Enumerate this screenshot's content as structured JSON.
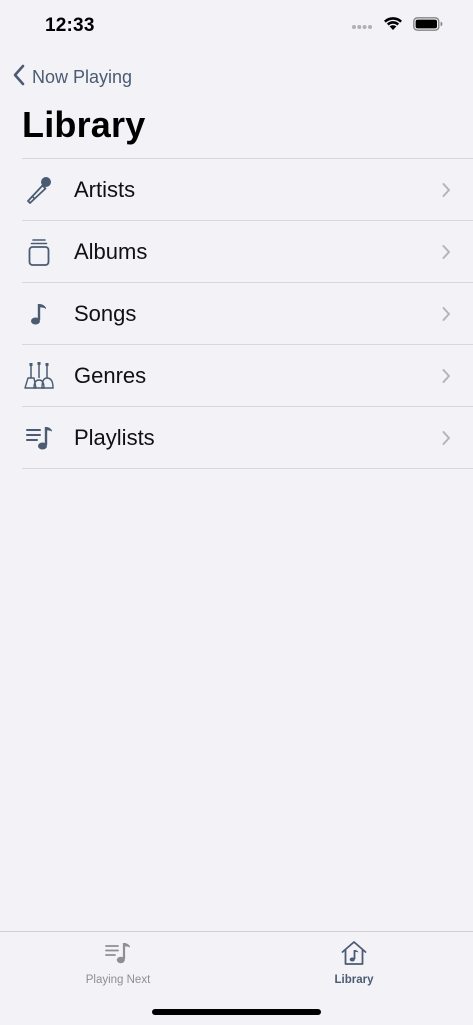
{
  "status_bar": {
    "time": "12:33",
    "icons": [
      "signal-dots-icon",
      "wifi-icon",
      "battery-icon"
    ]
  },
  "nav": {
    "back_label": "Now Playing",
    "back_icon": "chevron-left-icon"
  },
  "page": {
    "title": "Library"
  },
  "library": {
    "items": [
      {
        "label": "Artists",
        "icon": "microphone-icon"
      },
      {
        "label": "Albums",
        "icon": "album-stack-icon"
      },
      {
        "label": "Songs",
        "icon": "music-note-icon"
      },
      {
        "label": "Genres",
        "icon": "guitars-icon"
      },
      {
        "label": "Playlists",
        "icon": "playlist-icon"
      }
    ]
  },
  "tab_bar": {
    "tabs": [
      {
        "label": "Playing Next",
        "icon": "playlist-icon",
        "selected": false
      },
      {
        "label": "Library",
        "icon": "home-music-icon",
        "selected": true
      }
    ]
  },
  "colors": {
    "background": "#f2f2f7",
    "accent": "#4b5b72",
    "separator": "#d8d8dc",
    "inactive": "#8e8e93"
  }
}
